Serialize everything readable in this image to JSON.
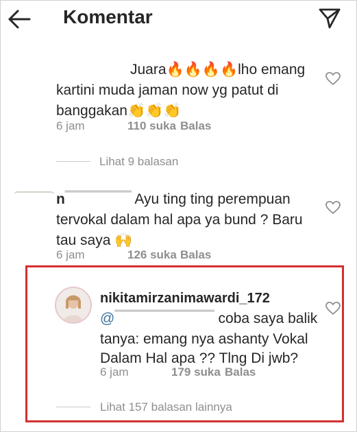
{
  "header": {
    "title": "Komentar",
    "back_icon": "arrow-left-icon",
    "send_icon": "send-paper-plane-icon"
  },
  "comments": [
    {
      "line1": "Juara",
      "line1_emoji": "🔥🔥🔥🔥",
      "line1_tail": "lho emang",
      "line2": "kartini muda jaman now yg patut di",
      "line3": "banggakan",
      "line3_emoji": "👏👏👏",
      "time": "6 jam",
      "likes": "110 suka",
      "reply": "Balas",
      "view_replies": "Lihat 9 balasan"
    },
    {
      "username_visible": "n",
      "line1": "Ayu ting ting perempuan",
      "line2": "tervokal dalam hal apa ya bund ? Baru",
      "line3": "tau saya",
      "line3_emoji": "🙌",
      "time": "6 jam",
      "likes": "126 suka",
      "reply": "Balas"
    },
    {
      "username": "nikitamirzanimawardi_172",
      "mention_prefix": "@",
      "line1_tail": "coba saya balik",
      "line2": "tanya: emang nya ashanty Vokal",
      "line3": "Dalam Hal apa ?? Tlng Di jwb?",
      "time": "6 jam",
      "likes": "179 suka",
      "reply": "Balas",
      "view_replies": "Lihat 157 balasan lainnya"
    }
  ],
  "colors": {
    "text": "#262626",
    "muted": "#8e8e8e",
    "highlight": "#d32f2f"
  }
}
